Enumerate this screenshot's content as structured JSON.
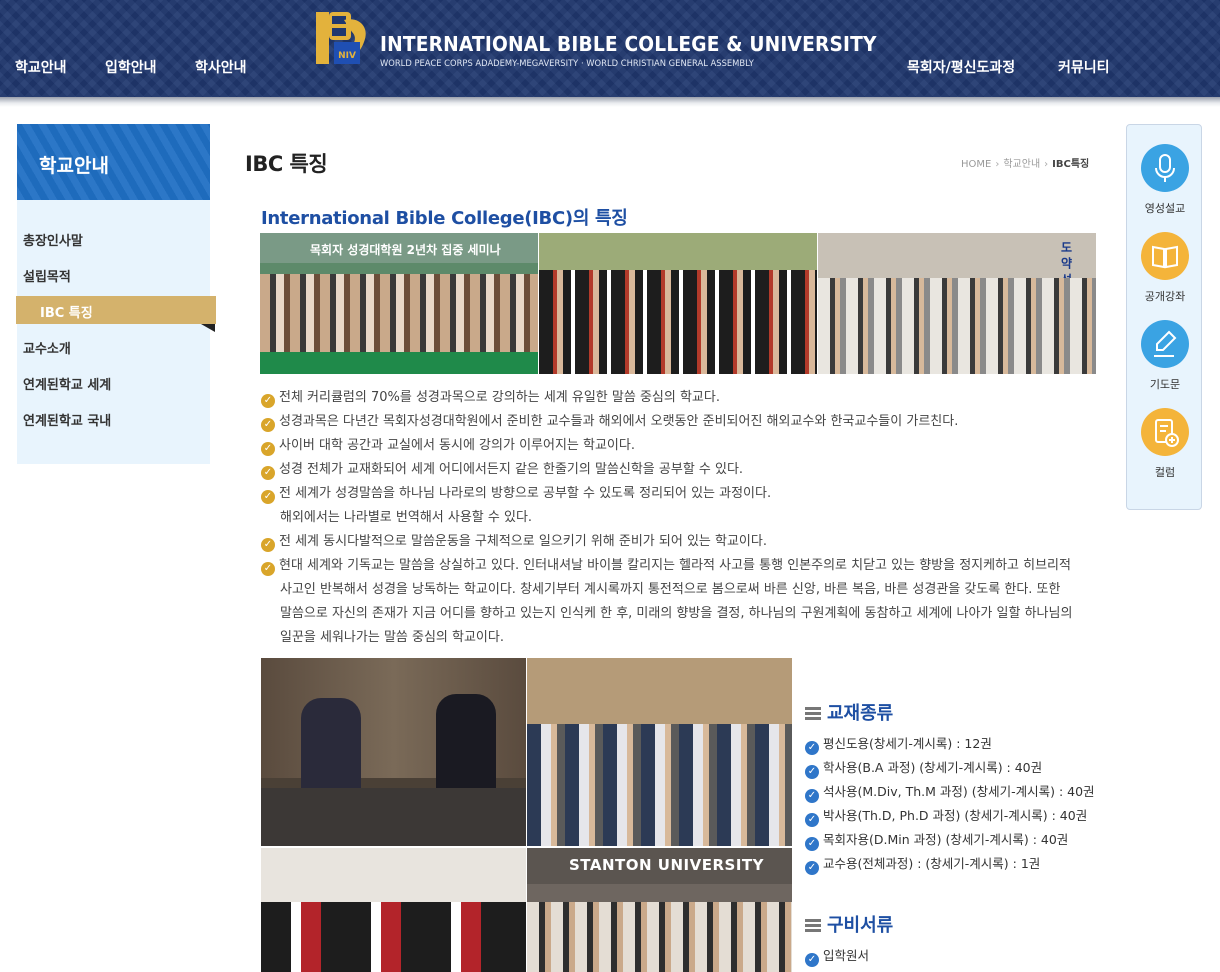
{
  "header": {
    "nav_left": [
      "학교안내",
      "입학안내",
      "학사안내"
    ],
    "nav_right": [
      "목회자/평신도과정",
      "커뮤니티"
    ],
    "logo_mark": "IBC UNIV",
    "logo_title": "INTERNATIONAL BIBLE COLLEGE & UNIVERSITY",
    "logo_subtitle": "WORLD PEACE CORPS ADADEMY-MEGAVERSITY · WORLD CHRISTIAN GENERAL ASSEMBLY",
    "colors": {
      "bar": "#20386f",
      "logo_gold": "#e3b23c",
      "logo_blue": "#1f4fb3"
    }
  },
  "sidebar": {
    "title": "학교안내",
    "items": [
      "총장인사말",
      "설립목적",
      "IBC 특징",
      "교수소개",
      "연계된학교 세계",
      "연계된학교 국내"
    ],
    "active_index": 2,
    "colors": {
      "title_bg": "#1f6fc4",
      "list_bg": "#e8f4fd",
      "active_bg": "#d4b26c"
    }
  },
  "page": {
    "title": "IBC 특징",
    "breadcrumb": [
      "HOME",
      "학교안내",
      "IBC특징"
    ],
    "section_heading": "International Bible College(IBC)의 특징"
  },
  "photos": {
    "top_banner_text": "목회자 성경대학원 2년차 집중 세미나",
    "top_right_sign": "도 약 성",
    "stanton_sign": "STANTON UNIVERSITY"
  },
  "features": [
    {
      "lines": [
        "전체 커리큘럼의 70%를 성경과목으로 강의하는 세계 유일한 말씀 중심의 학교다."
      ]
    },
    {
      "lines": [
        "성경과목은 다년간 목회자성경대학원에서 준비한 교수들과 해외에서 오랫동안 준비되어진 해외교수와 한국교수들이 가르친다."
      ]
    },
    {
      "lines": [
        "사이버 대학 공간과 교실에서 동시에 강의가 이루어지는 학교이다."
      ]
    },
    {
      "lines": [
        "성경 전체가 교재화되어 세계 어디에서든지 같은 한줄기의 말씀신학을 공부할 수 있다."
      ]
    },
    {
      "lines": [
        "전 세계가 성경말씀을 하나님 나라로의 방향으로 공부할 수 있도록 정리되어 있는 과정이다.",
        "해외에서는 나라별로 번역해서 사용할 수 있다."
      ]
    },
    {
      "lines": [
        "전 세계 동시다발적으로 말씀운동을 구체적으로 일으키기 위해 준비가 되어 있는 학교이다."
      ]
    },
    {
      "lines": [
        "현대 세계와 기독교는 말씀을 상실하고 있다. 인터내셔날 바이블 칼리지는 헬라적 사고를 통행 인본주의로 치닫고 있는 향방을 정지케하고 히브리적",
        "사고인 반복해서 성경을 낭독하는 학교이다. 창세기부터 계시록까지 통전적으로 봄으로써 바른 신앙, 바른 복음, 바른 성경관을 갖도록 한다. 또한",
        "말씀으로 자신의 존재가 지금 어디를 향하고 있는지 인식케 한 후, 미래의 향방을 결정, 하나님의 구원계획에 동참하고 세계에 나아가 일할 하나님의",
        "일꾼을 세워나가는 말씀 중심의 학교이다."
      ]
    }
  ],
  "textbooks": {
    "heading": "교재종류",
    "items": [
      "평신도용(창세기-계시록) : 12권",
      "학사용(B.A 과정) (창세기-계시록) : 40권",
      "석사용(M.Div, Th.M 과정) (창세기-계시록) : 40권",
      "박사용(Th.D, Ph.D 과정) (창세기-계시록) : 40권",
      "목회자용(D.Min 과정) (창세기-계시록) : 40권",
      "교수용(전체과정) : (창세기-계시록) : 1권"
    ]
  },
  "documents": {
    "heading": "구비서류",
    "items": [
      "입학원서"
    ]
  },
  "quick_menu": [
    {
      "label": "영성설교",
      "icon": "microphone-icon",
      "color": "#3aa3e3"
    },
    {
      "label": "공개강좌",
      "icon": "open-book-icon",
      "color": "#f4b43a"
    },
    {
      "label": "기도문",
      "icon": "pen-hand-icon",
      "color": "#3aa3e3"
    },
    {
      "label": "컬럼",
      "icon": "document-add-icon",
      "color": "#f4b43a"
    }
  ]
}
